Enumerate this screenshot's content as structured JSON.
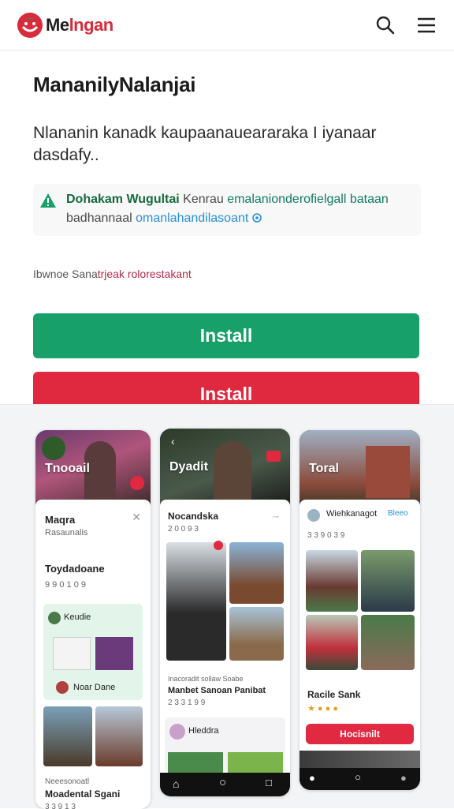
{
  "header": {
    "brand_dark": "Me",
    "brand_red": "lngan",
    "colors": {
      "brand_red": "#d62c3c",
      "brand_green": "#17a06a"
    }
  },
  "main": {
    "title": "MananilyNalanjai",
    "description": "Nlananin kanadk kaupaanaueararaka I iyanaar dasdafy..",
    "notice": {
      "bold": "Dohakam Wugultai",
      "text1": " Kenrau ",
      "teal": "emalanionderofielgall bataan",
      "text2": " badhannaal ",
      "link": "omanlahandilasoant",
      "icon": "warning-triangle-icon"
    },
    "meta": {
      "plain": "Ibwnoe Sana",
      "accent": "trjeak rolorestakant"
    },
    "install_primary": "Install",
    "install_secondary": "Install",
    "colors": {
      "install_primary": "#17a06a",
      "install_secondary": "#e0293f"
    }
  },
  "gallery": {
    "screens": [
      {
        "hero": "Tnooail",
        "header": "Maqra",
        "subheader": "Rasaunalis",
        "section": "Toydadoane",
        "rating": "9 9 0 1 0 9",
        "card_title": "Keudie",
        "card_user": "Noar Dane",
        "footer_small": "Neeesonoatl",
        "footer_title": "Moadental Sgani",
        "footer_rating": "3 3 9 1 3"
      },
      {
        "hero": "Dyadit",
        "header": "Nocandska",
        "rating": "2 0 0 9 3",
        "caption_small": "Inacoradit sollaw Soabe",
        "caption_title": "Manbet Sanoan Panibat",
        "caption_rating": "2 3 3 1 9 9",
        "footer_item": "Hleddra"
      },
      {
        "hero": "Toral",
        "header": "Wiehkanagot",
        "header_link": "Bleeo",
        "rating": "3 3 9 0 3 9",
        "card_title": "Racile Sank",
        "button": "Hocisnilt"
      }
    ]
  }
}
